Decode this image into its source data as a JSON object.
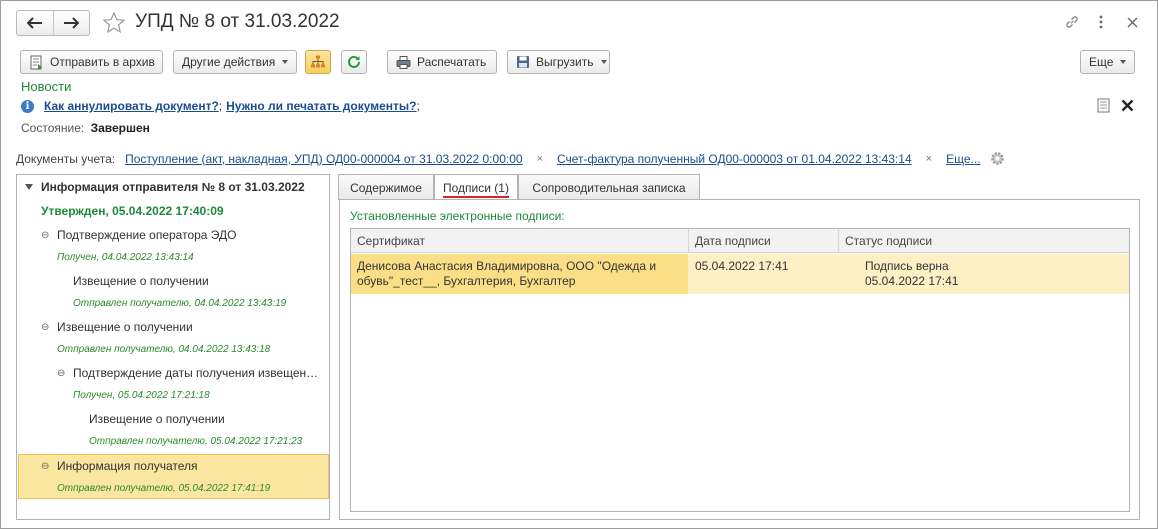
{
  "window": {
    "title": "УПД № 8 от 31.03.2022"
  },
  "toolbar": {
    "archive_label": "Отправить в архив",
    "other_actions_label": "Другие действия",
    "print_label": "Распечатать",
    "export_label": "Выгрузить",
    "more_label": "Еще"
  },
  "news": {
    "label": "Новости",
    "link1": "Как аннулировать документ?",
    "sep1": ";",
    "link2": "Нужно ли печатать документы?",
    "sep2": ";"
  },
  "state": {
    "label": "Состояние:",
    "value": "Завершен"
  },
  "docs": {
    "label": "Документы учета:",
    "items": [
      "Поступление (акт, накладная, УПД) ОД00-000004 от 31.03.2022 0:00:00",
      "Счет-фактура полученный ОД00-000003 от 01.04.2022 13:43:14"
    ],
    "remove_glyph": "×",
    "more": "Еще..."
  },
  "tree": {
    "root_title": "Информация отправителя № 8 от 31.03.2022",
    "root_status": "Утвержден, 05.04.2022 17:40:09",
    "nodes": [
      {
        "title": "Подтверждение оператора ЭДО",
        "sub": "Получен, 04.04.2022 13:43:14"
      },
      {
        "title": "Извещение о получении",
        "sub": "Отправлен получателю, 04.04.2022 13:43:19"
      },
      {
        "title": "Извещение о получении",
        "sub": "Отправлен получателю, 04.04.2022 13:43:18"
      },
      {
        "title": "Подтверждение даты получения извещен…",
        "sub": "Получен, 05.04.2022 17:21:18"
      },
      {
        "title": "Извещение о получении",
        "sub": "Отправлен получателю, 05.04.2022 17:21:23"
      },
      {
        "title": "Информация получателя",
        "sub": "Отправлен получателю, 05.04.2022 17:41:19"
      }
    ],
    "toggle_glyph": "⊖"
  },
  "tabs": [
    {
      "label": "Содержимое"
    },
    {
      "label": "Подписи (1)"
    },
    {
      "label": "Сопроводительная записка"
    }
  ],
  "signatures": {
    "title": "Установленные электронные подписи:",
    "columns": [
      "Сертификат",
      "Дата подписи",
      "Статус подписи"
    ],
    "rows": [
      {
        "certificate": "Денисова Анастасия Владимировна, ООО \"Одежда и обувь\"_тест__, Бухгалтерия, Бухгалтер",
        "date": "05.04.2022 17:41",
        "status_line1": "Подпись верна",
        "status_line2": "05.04.2022 17:41"
      }
    ]
  },
  "colors": {
    "accent_green": "#1e8a3a",
    "link_blue": "#1a4d8f",
    "selection_yellow": "#fbe6a0",
    "tab_underline": "#dd2222"
  },
  "icons": [
    "back-arrow-icon",
    "forward-arrow-icon",
    "star-icon",
    "link-icon",
    "kebab-menu-icon",
    "close-icon",
    "archive-icon",
    "structure-icon",
    "refresh-icon",
    "printer-icon",
    "save-icon",
    "info-icon",
    "document-icon",
    "gear-icon"
  ]
}
